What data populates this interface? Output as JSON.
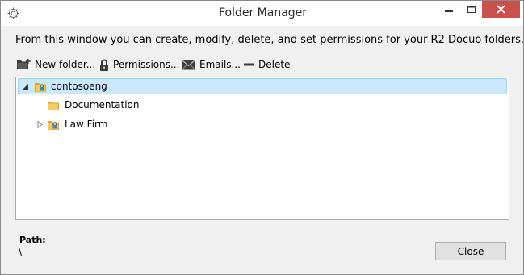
{
  "window": {
    "title": "Folder Manager",
    "icons": {
      "app": "gear-icon",
      "minimize": "minimize-icon",
      "maximize": "maximize-icon",
      "close": "close-icon"
    },
    "colors": {
      "close_button": "#c7514b",
      "selection": "#cce8ff",
      "selection_border": "#99d1ff"
    }
  },
  "description": "From this window you can create, modify, delete, and set permissions for your R2 Docuo folders.",
  "toolbar": {
    "new_folder": {
      "label": "New folder...",
      "icon": "new-folder-icon"
    },
    "permissions": {
      "label": "Permissions...",
      "icon": "lock-icon"
    },
    "emails": {
      "label": "Emails...",
      "icon": "envelope-icon"
    },
    "delete": {
      "label": "Delete",
      "icon": "minus-icon"
    }
  },
  "tree": {
    "items": [
      {
        "label": "contosoeng",
        "level": 0,
        "expanded": true,
        "selected": true,
        "icon": "locked-folder-icon"
      },
      {
        "label": "Documentation",
        "level": 1,
        "expanded": false,
        "selected": false,
        "icon": "folder-icon"
      },
      {
        "label": "Law Firm",
        "level": 1,
        "expanded": false,
        "selected": false,
        "icon": "locked-folder-icon",
        "has_children": true
      }
    ]
  },
  "path": {
    "label": "Path:",
    "value": "\\"
  },
  "buttons": {
    "close": "Close"
  }
}
